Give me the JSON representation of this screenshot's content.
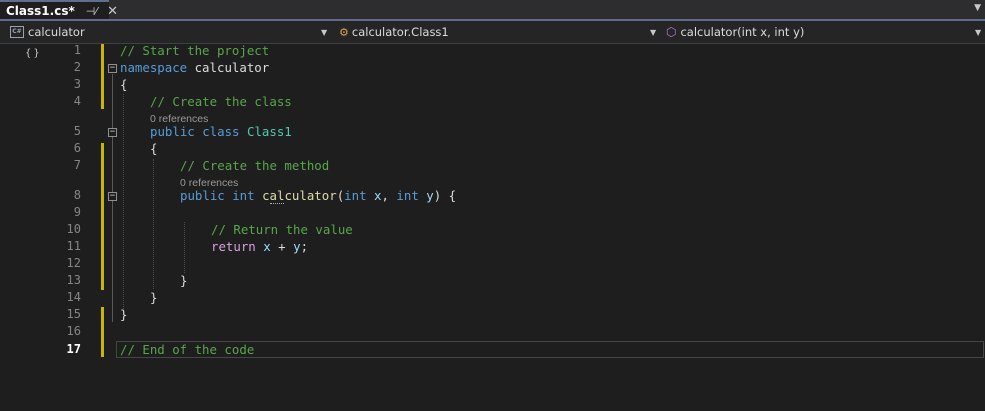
{
  "tab": {
    "title": "Class1.cs*",
    "pin_icon": "pin-icon",
    "close_icon": "close-icon"
  },
  "navbar": {
    "project": "calculator",
    "project_badge": "C#",
    "type": "calculator.Class1",
    "member": "calculator(int x, int y)"
  },
  "editor": {
    "current_line": 17,
    "hints": [
      "0 references",
      "0 references"
    ],
    "lines": [
      {
        "num": "1"
      },
      {
        "num": "2"
      },
      {
        "num": "3"
      },
      {
        "num": "4"
      },
      {
        "num": "5"
      },
      {
        "num": "6"
      },
      {
        "num": "7"
      },
      {
        "num": "8"
      },
      {
        "num": "9"
      },
      {
        "num": "10"
      },
      {
        "num": "11"
      },
      {
        "num": "12"
      },
      {
        "num": "13"
      },
      {
        "num": "14"
      },
      {
        "num": "15"
      },
      {
        "num": "16"
      },
      {
        "num": "17"
      }
    ],
    "tokens": {
      "l1_comment": "// Start the project",
      "l2_kw": "namespace",
      "l2_name": " calculator",
      "l3_brace": "{",
      "l4_comment": "// Create the class",
      "l5_kw": "public class",
      "l5_cls": "Class1",
      "l6_brace": "{",
      "l7_comment": "// Create the method",
      "l8_kw1": "public int",
      "l8_fn": "calculator",
      "l8_p1": "(",
      "l8_kw2": "int",
      "l8_x": "x",
      "l8_comma": ", ",
      "l8_kw3": "int",
      "l8_y": "y",
      "l8_end": ") {",
      "l10_comment": "// Return the value",
      "l11_ret": "return",
      "l11_x": "x",
      "l11_plus": " + ",
      "l11_y": "y",
      "l11_semi": ";",
      "l13_brace": "}",
      "l14_brace": "}",
      "l15_brace": "}",
      "l17_comment": "// End of the code"
    }
  },
  "colors": {
    "background": "#1e1e1e",
    "comment": "#57a64a",
    "keyword": "#569cd6",
    "control": "#d8a0df",
    "class": "#4ec9b0",
    "method": "#dcdcaa",
    "parameter": "#9cdcfe",
    "change_bar": "#c9b600"
  }
}
